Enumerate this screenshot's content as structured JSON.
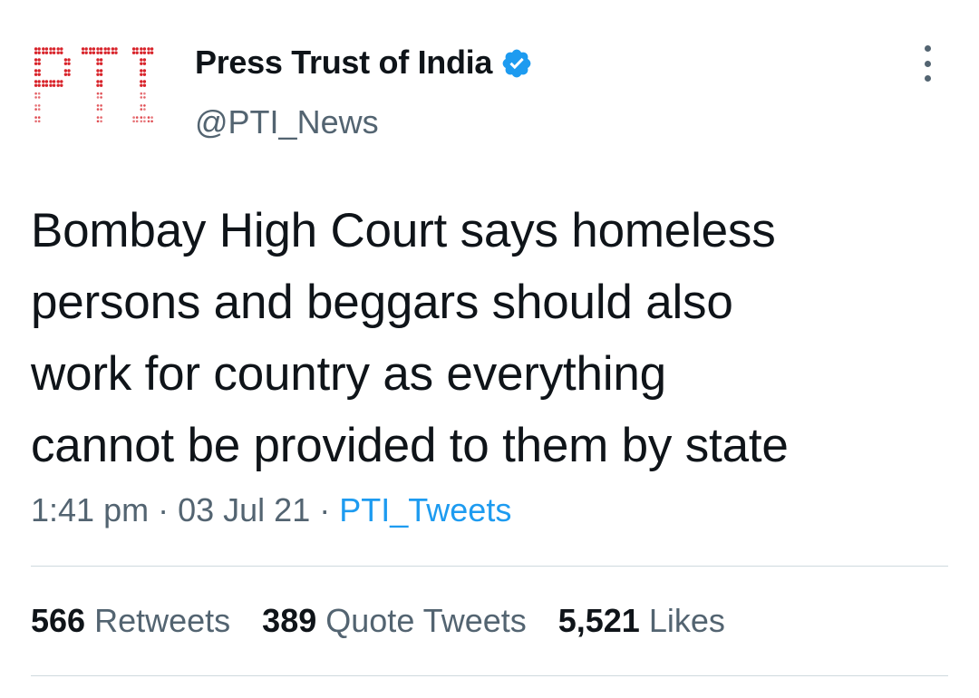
{
  "author": {
    "name": "Press Trust of India",
    "handle": "@PTI_News",
    "verified": true,
    "avatar_logo": "PTI"
  },
  "tweet": {
    "lines": [
      "Bombay High Court says homeless",
      "persons and beggars should also",
      "work for country as everything",
      "cannot be provided to them by state"
    ],
    "time": "1:41 pm",
    "date": "03 Jul 21",
    "separator": "·",
    "source": "PTI_Tweets"
  },
  "stats": {
    "retweets": {
      "count": "566",
      "label": "Retweets"
    },
    "quotes": {
      "count": "389",
      "label": "Quote Tweets"
    },
    "likes": {
      "count": "5,521",
      "label": "Likes"
    }
  },
  "colors": {
    "text": "#0f1419",
    "secondary": "#536471",
    "accent": "#1d9bf0",
    "logo_red": "#d8232a",
    "divider": "#cfd9de"
  },
  "icons": {
    "verified": "verified-badge-icon",
    "more": "more-options-icon"
  }
}
